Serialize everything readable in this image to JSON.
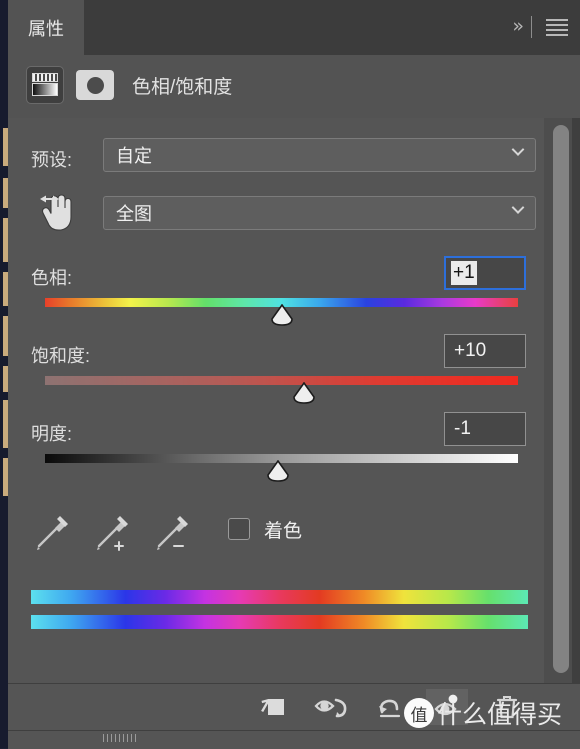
{
  "panel": {
    "tab_label": "属性",
    "overflow_icon": "double-chevron-right-icon",
    "menu_icon": "hamburger-menu-icon",
    "adjustment_title": "色相/饱和度",
    "adjustment_icon": "hue-saturation-adjustment-icon",
    "mask_icon": "layer-mask-thumbnail-icon"
  },
  "preset": {
    "label": "预设:",
    "value": "自定",
    "chevron_icon": "chevron-down-icon"
  },
  "range": {
    "hand_icon": "targeted-adjustment-hand-icon",
    "value": "全图",
    "chevron_icon": "chevron-down-icon"
  },
  "sliders": [
    {
      "id": "hue",
      "label": "色相:",
      "value": "+1",
      "focused": true,
      "thumb_percent": 50,
      "track": "hue-spectrum"
    },
    {
      "id": "saturation",
      "label": "饱和度:",
      "value": "+10",
      "focused": false,
      "thumb_percent": 54,
      "track": "saturation-gradient"
    },
    {
      "id": "lightness",
      "label": "明度:",
      "value": "-1",
      "focused": false,
      "thumb_percent": 49,
      "track": "lightness-gradient"
    }
  ],
  "tools": {
    "eyedropper": "eyedropper-icon",
    "eyedropper_add": "eyedropper-add-icon",
    "eyedropper_subtract": "eyedropper-subtract-icon",
    "colorize_label": "着色",
    "colorize_checked": false
  },
  "spectrum": {
    "top_bar": "hue-spectrum-before-bar",
    "bottom_bar": "hue-spectrum-after-bar"
  },
  "footer": {
    "clip_label": "clip-to-layer-icon",
    "preview_label": "toggle-layer-visibility-icon",
    "reset_label": "reset-adjustment-icon",
    "preview_toggle_label": "preview-eye-icon",
    "delete_label": "delete-adjustment-layer-icon"
  },
  "watermark": {
    "logo_char": "值",
    "text": "什么值得买"
  },
  "colors": {
    "panel_bg": "#555555",
    "tabbar_bg": "#3c3c3c",
    "focus_blue": "#2d6fdb",
    "text": "#e8e8e8",
    "doc_edge": "#171b2e",
    "doc_edge_accent": "#c9ab7d"
  }
}
